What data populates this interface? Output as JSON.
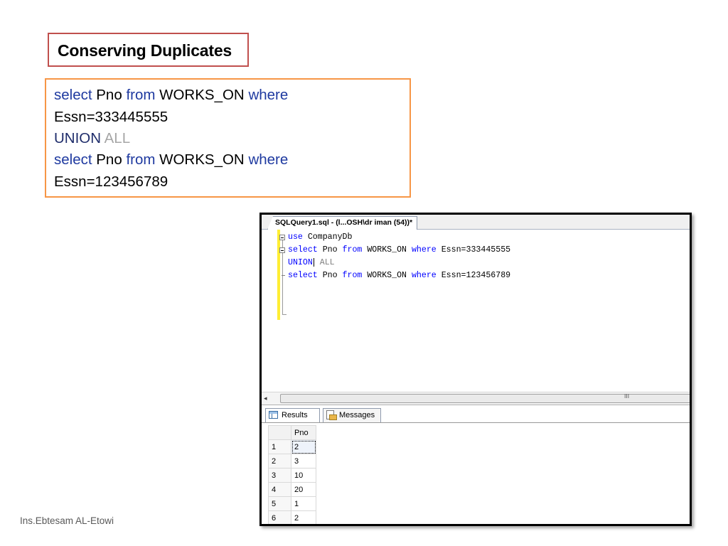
{
  "slide": {
    "title": "Conserving Duplicates",
    "code": {
      "line1": {
        "kw1": "select",
        "t1": " Pno ",
        "kw2": "from",
        "t2": " WORKS_ON ",
        "kw3": "where"
      },
      "line2": "Essn=333445555",
      "line3": {
        "kw1": "UNION",
        "kw2": " ALL"
      },
      "line4": {
        "kw1": "select",
        "t1": " Pno ",
        "kw2": "from",
        "t2": " WORKS_ON ",
        "kw3": "where"
      },
      "line5": "Essn=123456789"
    },
    "footer": "Ins.Ebtesam AL-Etowi"
  },
  "ssms": {
    "tab_title": "SQLQuery1.sql - (l...OSH\\dr iman (54))*",
    "editor": {
      "line1": {
        "kw": "use",
        "rest": " CompanyDb"
      },
      "line2": {
        "kw1": "select",
        "t1": " Pno ",
        "kw2": "from",
        "t2": " WORKS_ON ",
        "kw3": "where",
        "t3": " Essn=333445555"
      },
      "line3": {
        "kw1": "UNION",
        "kw2": " ALL"
      },
      "line4": {
        "kw1": "select",
        "t1": " Pno ",
        "kw2": "from",
        "t2": " WORKS_ON ",
        "kw3": "where",
        "t3": " Essn=123456789"
      }
    },
    "scroll_grip": "III",
    "scroll_left_arrow": "◂",
    "results_tab": "Results",
    "messages_tab": "Messages",
    "grid": {
      "column": "Pno",
      "rows": [
        {
          "n": "1",
          "pno": "2"
        },
        {
          "n": "2",
          "pno": "3"
        },
        {
          "n": "3",
          "pno": "10"
        },
        {
          "n": "4",
          "pno": "20"
        },
        {
          "n": "5",
          "pno": "1"
        },
        {
          "n": "6",
          "pno": "2"
        }
      ]
    },
    "colors": {
      "keyword": "#0000ff",
      "operator_gray": "#808080",
      "margin_yellow": "#ffee33"
    }
  }
}
